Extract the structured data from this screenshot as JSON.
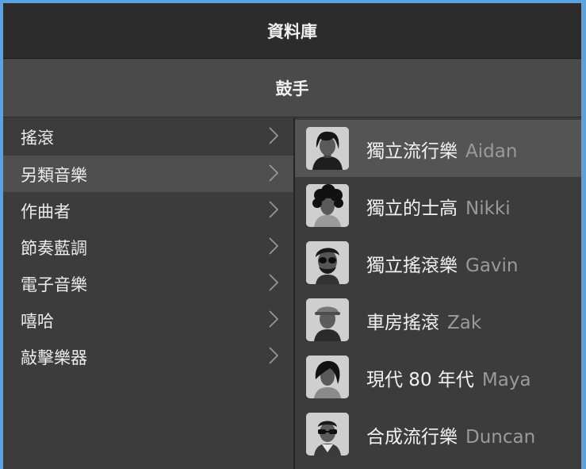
{
  "header": {
    "title": "資料庫"
  },
  "subheader": {
    "title": "鼓手"
  },
  "categories": [
    {
      "label": "搖滾"
    },
    {
      "label": "另類音樂"
    },
    {
      "label": "作曲者"
    },
    {
      "label": "節奏藍調"
    },
    {
      "label": "電子音樂"
    },
    {
      "label": "嘻哈"
    },
    {
      "label": "敲擊樂器"
    }
  ],
  "selected_category": "另類音樂",
  "drummers": [
    {
      "genre": "獨立流行樂",
      "name": "Aidan"
    },
    {
      "genre": "獨立的士高",
      "name": "Nikki"
    },
    {
      "genre": "獨立搖滾樂",
      "name": "Gavin"
    },
    {
      "genre": "車房搖滾",
      "name": "Zak"
    },
    {
      "genre": "現代 80 年代",
      "name": "Maya"
    },
    {
      "genre": "合成流行樂",
      "name": "Duncan"
    }
  ],
  "selected_drummer": "Aidan",
  "colors": {
    "background": "#5ba3de",
    "panel": "#3c3c3c",
    "selected_row": "#545454"
  }
}
